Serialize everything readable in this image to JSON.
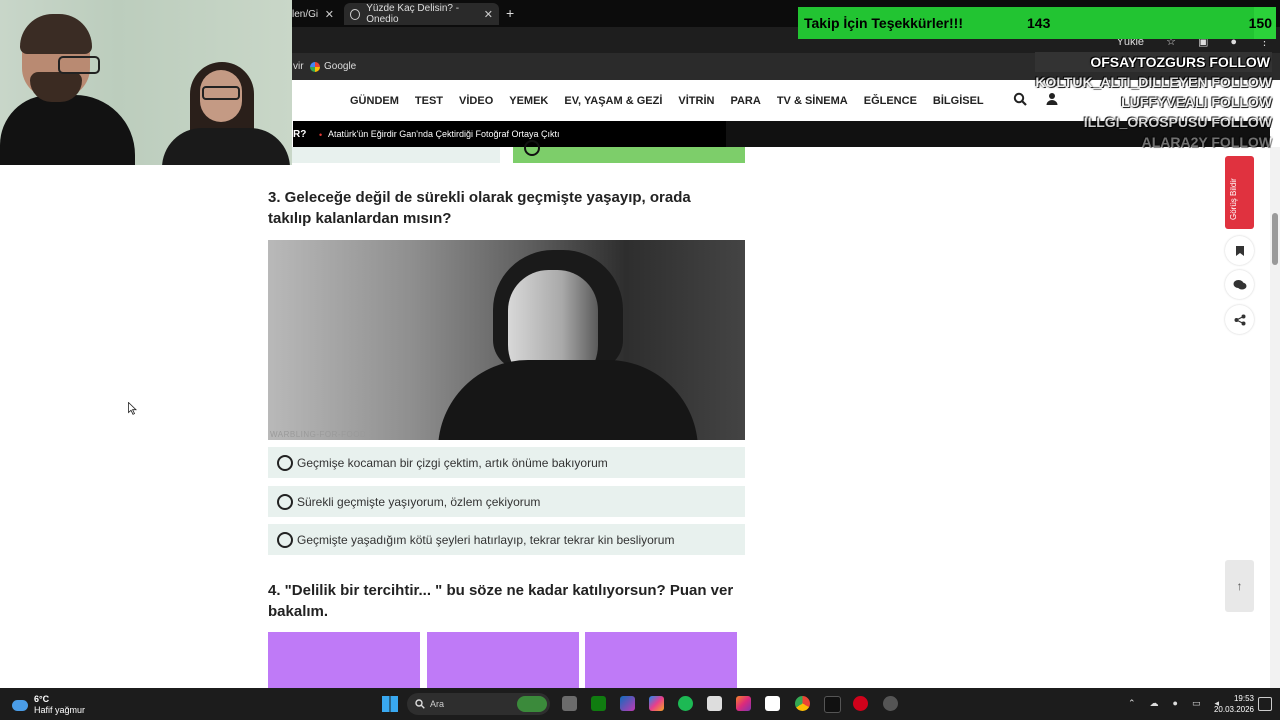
{
  "browser": {
    "tabs": [
      {
        "label": "len/Gi",
        "close": "✕"
      },
      {
        "label": "Yüzde Kaç Delisin? - Onedio",
        "close": "✕"
      }
    ],
    "new_tab": "+",
    "bookmark_prefix": "vir",
    "bookmark_google": "Google",
    "toolbar_upload": "Yükle"
  },
  "site": {
    "nav_items": [
      "GÜNDEM",
      "TEST",
      "VİDEO",
      "YEMEK",
      "EV, YAŞAM & GEZİ",
      "VİTRİN",
      "PARA",
      "TV & SİNEMA",
      "EĞLENCE",
      "BİLGİSEL"
    ],
    "ticker_label": "R?",
    "ticker_text": "Atatürk'ün Eğirdir Gan'nda Çektirdiği Fotoğraf Ortaya Çıktı"
  },
  "quiz": {
    "q3": "3. Geleceğe değil de sürekli olarak geçmişte yaşayıp, orada takılıp kalanlardan mısın?",
    "q3_watermark": "WARBLING-FOR-FOOD",
    "q3_options": [
      "Geçmişe kocaman bir çizgi çektim, artık önüme bakıyorum",
      "Sürekli geçmişte yaşıyorum, özlem çekiyorum",
      "Geçmişte yaşadığım kötü şeyleri hatırlayıp, tekrar tekrar kin besliyorum"
    ],
    "q4": "4. \"Delilik bir tercihtir... \" bu söze ne kadar katılıyorsun? Puan ver bakalım."
  },
  "rail": {
    "feedback": "Görüş Bildir",
    "up": "↑"
  },
  "stream": {
    "alert_title": "Takip İçin Teşekkürler!!!",
    "alert_current": "143",
    "alert_goal": "150",
    "alert_progress": 0.953,
    "followers": [
      "OFSAYTOZGURS  FOLLOW",
      "KOLTUK_ALTI_DILLEYEN  FOLLOW",
      "LUFFYVEALI  FOLLOW",
      "ILLGI_OROSPUSU  FOLLOW",
      "ALARA2Y  FOLLOW"
    ]
  },
  "taskbar": {
    "temp": "6°C",
    "weather": "Hafif yağmur",
    "search": "Ara",
    "time": "19:53",
    "date": "20.03.2026"
  }
}
